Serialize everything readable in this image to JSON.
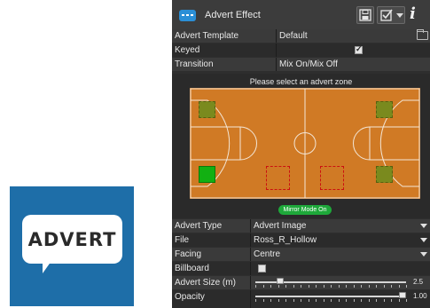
{
  "logo": {
    "text": "ADVERT"
  },
  "window": {
    "title": "Advert Effect"
  },
  "properties": {
    "advert_template": {
      "label": "Advert Template",
      "value": "Default"
    },
    "keyed": {
      "label": "Keyed",
      "checked": true
    },
    "transition": {
      "label": "Transition",
      "value": "Mix On/Mix Off"
    }
  },
  "court": {
    "prompt": "Please select an advert zone",
    "mirror_button": "Mirror Mode On",
    "zones": [
      {
        "side": "left",
        "position": "top",
        "state": "filled"
      },
      {
        "side": "left",
        "position": "bottom",
        "state": "selected"
      },
      {
        "side": "center-left",
        "position": "bottom",
        "state": "empty"
      },
      {
        "side": "center-right",
        "position": "bottom",
        "state": "empty"
      },
      {
        "side": "right",
        "position": "top",
        "state": "filled"
      },
      {
        "side": "right",
        "position": "bottom",
        "state": "filled"
      }
    ]
  },
  "settings": {
    "advert_type": {
      "label": "Advert Type",
      "value": "Advert Image"
    },
    "file": {
      "label": "File",
      "value": "Ross_R_Hollow"
    },
    "facing": {
      "label": "Facing",
      "value": "Centre"
    },
    "billboard": {
      "label": "Billboard",
      "checked": false
    },
    "advert_size": {
      "label": "Advert Size (m)",
      "value": "2.5"
    },
    "opacity": {
      "label": "Opacity",
      "value": "1.00"
    }
  },
  "colors": {
    "court": "#d07a25",
    "zone_filled": "#7a8a1e",
    "zone_selected": "#12b012",
    "zone_empty_border": "#cc1010",
    "mirror_button": "#1ea83a",
    "logo_bg": "#1e6ea8"
  }
}
